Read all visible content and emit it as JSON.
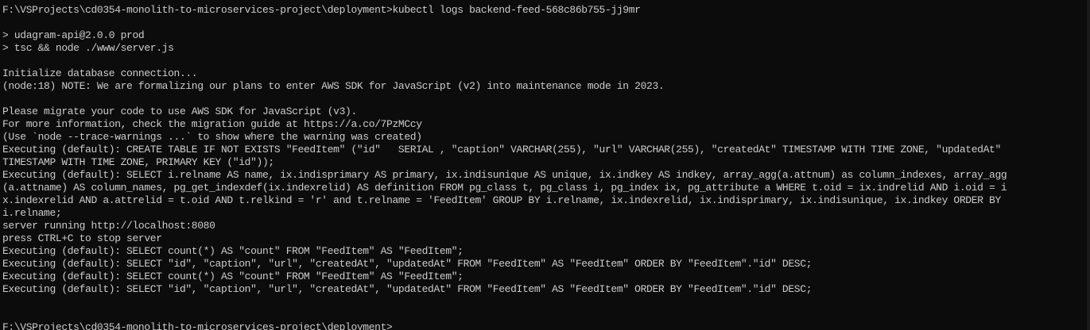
{
  "terminal": {
    "lines": [
      "F:\\VSProjects\\cd0354-monolith-to-microservices-project\\deployment>kubectl logs backend-feed-568c86b755-jj9mr",
      "",
      "> udagram-api@2.0.0 prod",
      "> tsc && node ./www/server.js",
      "",
      "Initialize database connection...",
      "(node:18) NOTE: We are formalizing our plans to enter AWS SDK for JavaScript (v2) into maintenance mode in 2023.",
      "",
      "Please migrate your code to use AWS SDK for JavaScript (v3).",
      "For more information, check the migration guide at https://a.co/7PzMCcy",
      "(Use `node --trace-warnings ...` to show where the warning was created)",
      "Executing (default): CREATE TABLE IF NOT EXISTS \"FeedItem\" (\"id\"   SERIAL , \"caption\" VARCHAR(255), \"url\" VARCHAR(255), \"createdAt\" TIMESTAMP WITH TIME ZONE, \"updatedAt\"",
      "TIMESTAMP WITH TIME ZONE, PRIMARY KEY (\"id\"));",
      "Executing (default): SELECT i.relname AS name, ix.indisprimary AS primary, ix.indisunique AS unique, ix.indkey AS indkey, array_agg(a.attnum) as column_indexes, array_agg",
      "(a.attname) AS column_names, pg_get_indexdef(ix.indexrelid) AS definition FROM pg_class t, pg_class i, pg_index ix, pg_attribute a WHERE t.oid = ix.indrelid AND i.oid = i",
      "x.indexrelid AND a.attrelid = t.oid AND t.relkind = 'r' and t.relname = 'FeedItem' GROUP BY i.relname, ix.indexrelid, ix.indisprimary, ix.indisunique, ix.indkey ORDER BY",
      "i.relname;",
      "server running http://localhost:8080",
      "press CTRL+C to stop server",
      "Executing (default): SELECT count(*) AS \"count\" FROM \"FeedItem\" AS \"FeedItem\";",
      "Executing (default): SELECT \"id\", \"caption\", \"url\", \"createdAt\", \"updatedAt\" FROM \"FeedItem\" AS \"FeedItem\" ORDER BY \"FeedItem\".\"id\" DESC;",
      "Executing (default): SELECT count(*) AS \"count\" FROM \"FeedItem\" AS \"FeedItem\";",
      "Executing (default): SELECT \"id\", \"caption\", \"url\", \"createdAt\", \"updatedAt\" FROM \"FeedItem\" AS \"FeedItem\" ORDER BY \"FeedItem\".\"id\" DESC;",
      "",
      ""
    ],
    "prompt": "F:\\VSProjects\\cd0354-monolith-to-microservices-project\\deployment>",
    "colors": {
      "background": "#0c0c0c",
      "foreground": "#cccccc"
    }
  }
}
